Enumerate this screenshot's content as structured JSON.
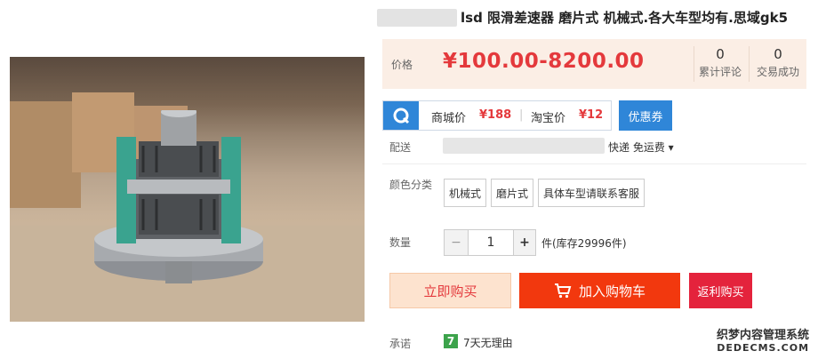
{
  "product": {
    "title": "lsd 限滑差速器 磨片式 机械式.各大车型均有.思域gk5",
    "image_name": "differential-photo"
  },
  "price_panel": {
    "label": "价格",
    "price": "¥100.00-8200.00",
    "stats": [
      {
        "value": "0",
        "label": "累计评论"
      },
      {
        "value": "0",
        "label": "交易成功"
      }
    ]
  },
  "promo": {
    "mall_label": "商城价",
    "mall_price": "¥188",
    "taobao_label": "淘宝价",
    "taobao_price": "¥12",
    "coupon": "优惠券"
  },
  "shipping": {
    "label": "配送",
    "method": "快递 免运费 ▾"
  },
  "color": {
    "label": "颜色分类",
    "options": [
      "机械式",
      "磨片式",
      "具体车型请联系客服"
    ]
  },
  "quantity": {
    "label": "数量",
    "value": "1",
    "minus": "−",
    "plus": "+",
    "stock": "件(库存29996件)"
  },
  "actions": {
    "buy_now": "立即购买",
    "add_cart": "加入购物车",
    "rebate": "返利购买"
  },
  "promise": {
    "label": "承诺",
    "badge": "7",
    "text": "7天无理由"
  },
  "watermark": {
    "line1": "织梦内容管理系统",
    "line2": "DEDECMS.COM"
  },
  "colors": {
    "accent_red": "#e4393c",
    "cart_red": "#f2380e",
    "blue": "#2f86d8",
    "price_bg": "#fbeee5"
  }
}
